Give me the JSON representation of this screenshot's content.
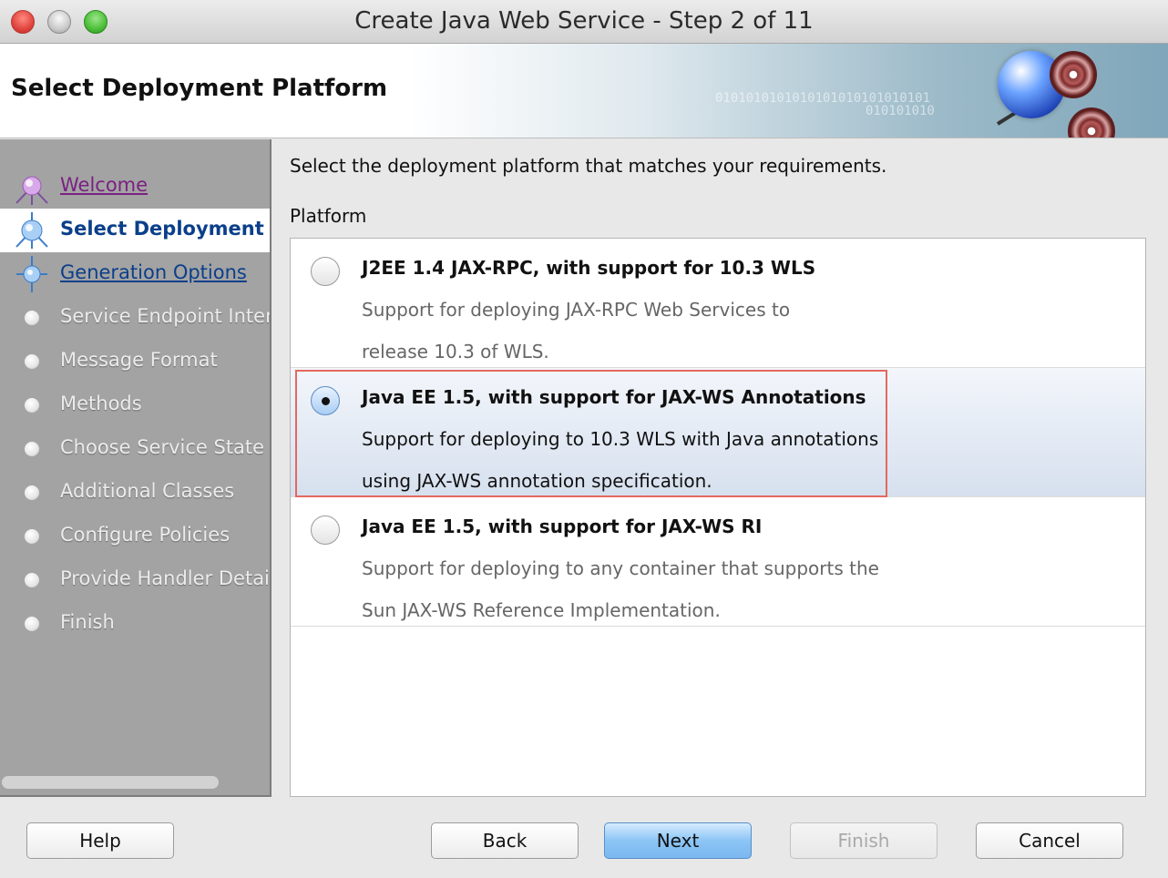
{
  "window": {
    "title": "Create Java Web Service - Step 2 of 11"
  },
  "header": {
    "title": "Select Deployment Platform",
    "binary_line1": "0101010101010101010101010101",
    "binary_line2": "010101010"
  },
  "nav": {
    "items": [
      {
        "label": "Welcome",
        "state": "visited"
      },
      {
        "label": "Select Deployment Platform",
        "state": "current"
      },
      {
        "label": "Generation Options",
        "state": "link"
      },
      {
        "label": "Service Endpoint Interface",
        "state": "disabled"
      },
      {
        "label": "Message Format",
        "state": "disabled"
      },
      {
        "label": "Methods",
        "state": "disabled"
      },
      {
        "label": "Choose Service State",
        "state": "disabled"
      },
      {
        "label": "Additional Classes",
        "state": "disabled"
      },
      {
        "label": "Configure Policies",
        "state": "disabled"
      },
      {
        "label": "Provide Handler Details",
        "state": "disabled"
      },
      {
        "label": "Finish",
        "state": "disabled"
      }
    ]
  },
  "main": {
    "instructions": "Select the deployment platform that matches your requirements.",
    "platform_label": "Platform",
    "options": [
      {
        "title": "J2EE 1.4 JAX-RPC, with support for 10.3 WLS",
        "desc_line1": "Support for deploying JAX-RPC Web Services to",
        "desc_line2": "release 10.3 of WLS.",
        "selected": false
      },
      {
        "title": "Java EE 1.5, with support for JAX-WS Annotations",
        "desc_line1": "Support for deploying to 10.3 WLS with Java annotations",
        "desc_line2": "using JAX-WS annotation specification.",
        "selected": true
      },
      {
        "title": "Java EE 1.5, with support for JAX-WS RI",
        "desc_line1": "Support for deploying to any container that supports the",
        "desc_line2": "Sun JAX-WS Reference Implementation.",
        "selected": false
      }
    ]
  },
  "buttons": {
    "help": "Help",
    "back": "Back",
    "next": "Next",
    "finish": "Finish",
    "cancel": "Cancel"
  }
}
